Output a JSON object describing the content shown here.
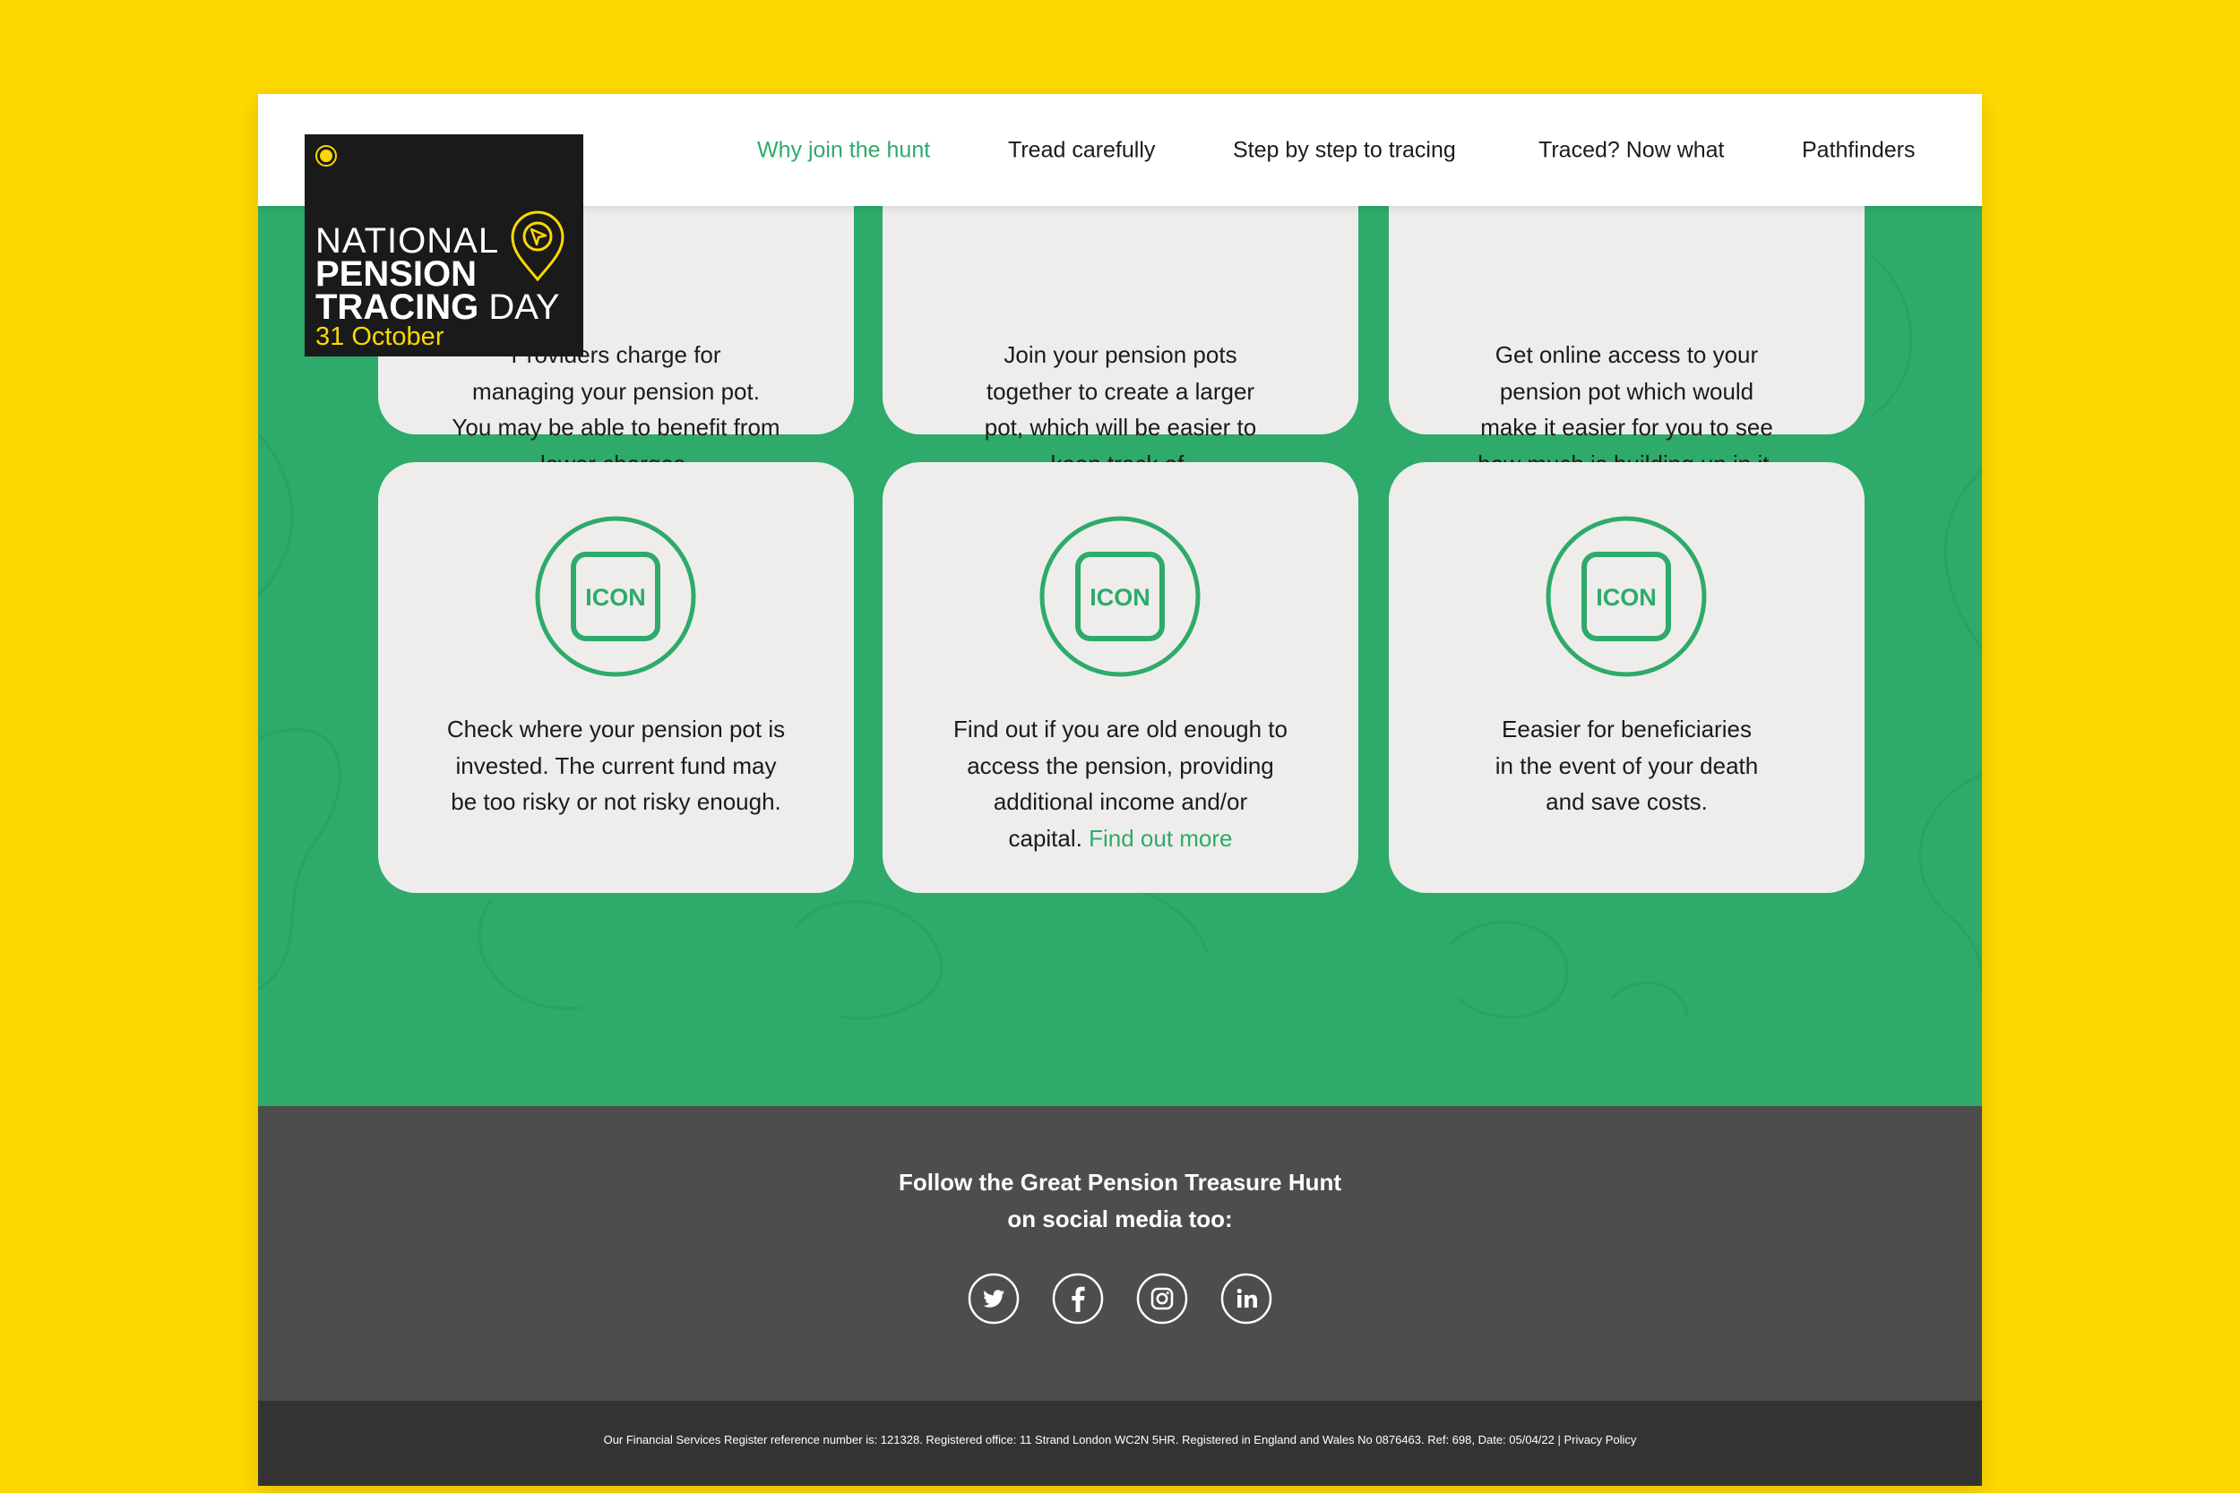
{
  "nav": {
    "items": [
      {
        "label": "Why join the hunt",
        "active": true
      },
      {
        "label": "Tread carefully",
        "active": false
      },
      {
        "label": "Step by step to tracing",
        "active": false
      },
      {
        "label": "Traced? Now what",
        "active": false
      },
      {
        "label": "Pathfinders",
        "active": false
      }
    ]
  },
  "logo": {
    "line1": "NATIONAL",
    "line2": "PENSION",
    "line3_bold": "TRACING",
    "line3_light": " DAY",
    "date": "31 October"
  },
  "cards_top": [
    {
      "lines": [
        "Providers charge for",
        "managing your pension pot.",
        "You may be able to benefit from",
        "lower charges."
      ]
    },
    {
      "lines": [
        "Join your pension pots",
        "together to create a larger",
        "pot, which will be easier to",
        "keep track of."
      ]
    },
    {
      "lines": [
        "Get online access to your",
        "pension pot which would",
        "make it easier for you to see",
        "how much is building up in it."
      ]
    }
  ],
  "cards_bottom": [
    {
      "icon_label": "ICON",
      "lines": [
        "Check where your pension pot is",
        "invested. The current fund may",
        "be too risky or not risky enough."
      ]
    },
    {
      "icon_label": "ICON",
      "lines": [
        "Find out if you are old enough to",
        "access the pension, providing",
        "additional income and/or"
      ],
      "last_prefix": "capital. ",
      "link": "Find out more"
    },
    {
      "icon_label": "ICON",
      "lines": [
        "Eeasier for beneficiaries",
        "in the event of your death",
        "and save costs."
      ]
    }
  ],
  "footer": {
    "follow_line1": "Follow the Great Pension Treasure Hunt",
    "follow_line2": "on social media too:",
    "social": [
      "twitter-icon",
      "facebook-icon",
      "instagram-icon",
      "linkedin-icon"
    ],
    "legal": "Our Financial Services Register reference number is: 121328. Registered office: 11 Strand London WC2N 5HR. Registered in England and Wales No 0876463. Ref: 698, Date: 05/04/22",
    "separator": " | ",
    "privacy": "Privacy Policy"
  },
  "colors": {
    "page_bg": "#FDD800",
    "green": "#2EAA6A",
    "card": "#EEEDEB",
    "footer": "#4D4D4D",
    "legal_bar": "#333333",
    "logo_bg": "#1A1A1A"
  }
}
